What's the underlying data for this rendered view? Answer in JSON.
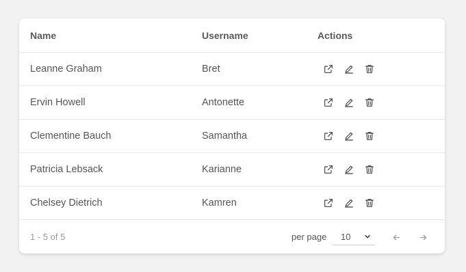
{
  "table": {
    "columns": [
      "Name",
      "Username",
      "Actions"
    ],
    "rows": [
      {
        "name": "Leanne Graham",
        "username": "Bret"
      },
      {
        "name": "Ervin Howell",
        "username": "Antonette"
      },
      {
        "name": "Clementine Bauch",
        "username": "Samantha"
      },
      {
        "name": "Patricia Lebsack",
        "username": "Karianne"
      },
      {
        "name": "Chelsey Dietrich",
        "username": "Kamren"
      }
    ],
    "row_actions": [
      "open-external-icon",
      "edit-icon",
      "delete-icon"
    ]
  },
  "pagination": {
    "range_text": "1 - 5 of 5",
    "per_page_label": "per page",
    "per_page_value": "10",
    "prev_icon": "arrow-left-icon",
    "next_icon": "arrow-right-icon"
  }
}
